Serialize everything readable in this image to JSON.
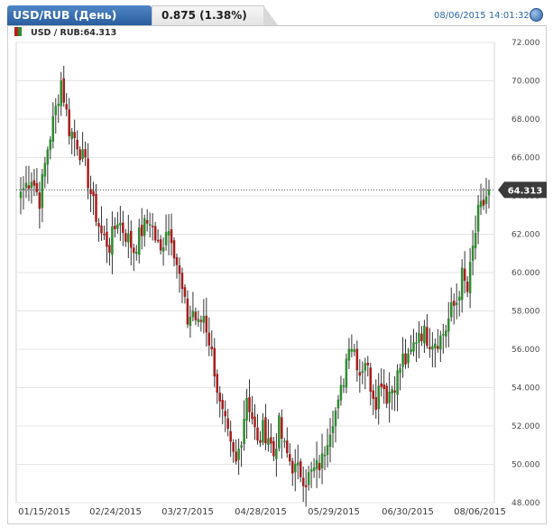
{
  "header": {
    "title": "USD/RUB (День)",
    "change": "0.875 (1.38%)",
    "datetime": "08/06/2015 14:01:32",
    "info_icon": "info-circle-icon"
  },
  "legend": {
    "label": "USD / RUB:64.313"
  },
  "colors": {
    "up": "#2f8a2f",
    "down": "#a51d1d",
    "accent": "#2c66a6",
    "grid": "#e6e6e6"
  },
  "chart_data": {
    "type": "candlestick",
    "y_axis": {
      "min": 48,
      "max": 72,
      "ticks": [
        "48.000",
        "50.000",
        "52.000",
        "54.000",
        "56.000",
        "58.000",
        "60.000",
        "62.000",
        "64.000",
        "66.000",
        "68.000",
        "70.000",
        "72.000"
      ]
    },
    "x_axis": {
      "tick_labels": [
        "01/15/2015",
        "02/24/2015",
        "03/27/2015",
        "04/28/2015",
        "05/29/2015",
        "06/30/2015",
        "08/06/2015"
      ]
    },
    "last_value": 64.313,
    "last_value_label": "64.313",
    "grid": true,
    "keypoints": [
      [
        0,
        64.2
      ],
      [
        4,
        65.0
      ],
      [
        7,
        63.8
      ],
      [
        10,
        66.5
      ],
      [
        13,
        68.5
      ],
      [
        15,
        70.0
      ],
      [
        18,
        67.5
      ],
      [
        21,
        66.8
      ],
      [
        24,
        65.5
      ],
      [
        27,
        63.5
      ],
      [
        30,
        62.0
      ],
      [
        33,
        61.4
      ],
      [
        36,
        62.8
      ],
      [
        39,
        62.0
      ],
      [
        42,
        61.2
      ],
      [
        45,
        62.2
      ],
      [
        48,
        62.8
      ],
      [
        50,
        61.8
      ],
      [
        52,
        61.0
      ],
      [
        54,
        62.4
      ],
      [
        56,
        62.0
      ],
      [
        58,
        60.5
      ],
      [
        60,
        59.0
      ],
      [
        62,
        57.5
      ],
      [
        64,
        58.0
      ],
      [
        66,
        57.2
      ],
      [
        68,
        57.8
      ],
      [
        70,
        56.5
      ],
      [
        72,
        55.0
      ],
      [
        74,
        53.0
      ],
      [
        76,
        52.0
      ],
      [
        78,
        50.8
      ],
      [
        80,
        50.0
      ],
      [
        82,
        51.5
      ],
      [
        84,
        53.6
      ],
      [
        86,
        52.5
      ],
      [
        88,
        51.0
      ],
      [
        90,
        51.8
      ],
      [
        92,
        51.5
      ],
      [
        94,
        50.5
      ],
      [
        96,
        52.0
      ],
      [
        98,
        50.8
      ],
      [
        100,
        50.2
      ],
      [
        102,
        49.7
      ],
      [
        104,
        49.6
      ],
      [
        106,
        49.2
      ],
      [
        108,
        49.5
      ],
      [
        110,
        49.8
      ],
      [
        112,
        50.2
      ],
      [
        114,
        51.5
      ],
      [
        116,
        52.5
      ],
      [
        118,
        53.0
      ],
      [
        120,
        54.5
      ],
      [
        122,
        56.5
      ],
      [
        124,
        56.0
      ],
      [
        126,
        54.8
      ],
      [
        128,
        55.5
      ],
      [
        130,
        54.2
      ],
      [
        132,
        53.4
      ],
      [
        134,
        54.5
      ],
      [
        136,
        53.6
      ],
      [
        138,
        54.0
      ],
      [
        140,
        54.6
      ],
      [
        142,
        55.5
      ],
      [
        144,
        55.3
      ],
      [
        146,
        56.2
      ],
      [
        148,
        57.0
      ],
      [
        150,
        56.8
      ],
      [
        152,
        56.5
      ],
      [
        154,
        56.5
      ],
      [
        156,
        56.6
      ],
      [
        158,
        57.1
      ],
      [
        160,
        58.0
      ],
      [
        162,
        58.5
      ],
      [
        164,
        59.8
      ],
      [
        166,
        59.0
      ],
      [
        168,
        61.2
      ],
      [
        170,
        63.0
      ],
      [
        172,
        63.6
      ],
      [
        174,
        64.313
      ]
    ]
  }
}
